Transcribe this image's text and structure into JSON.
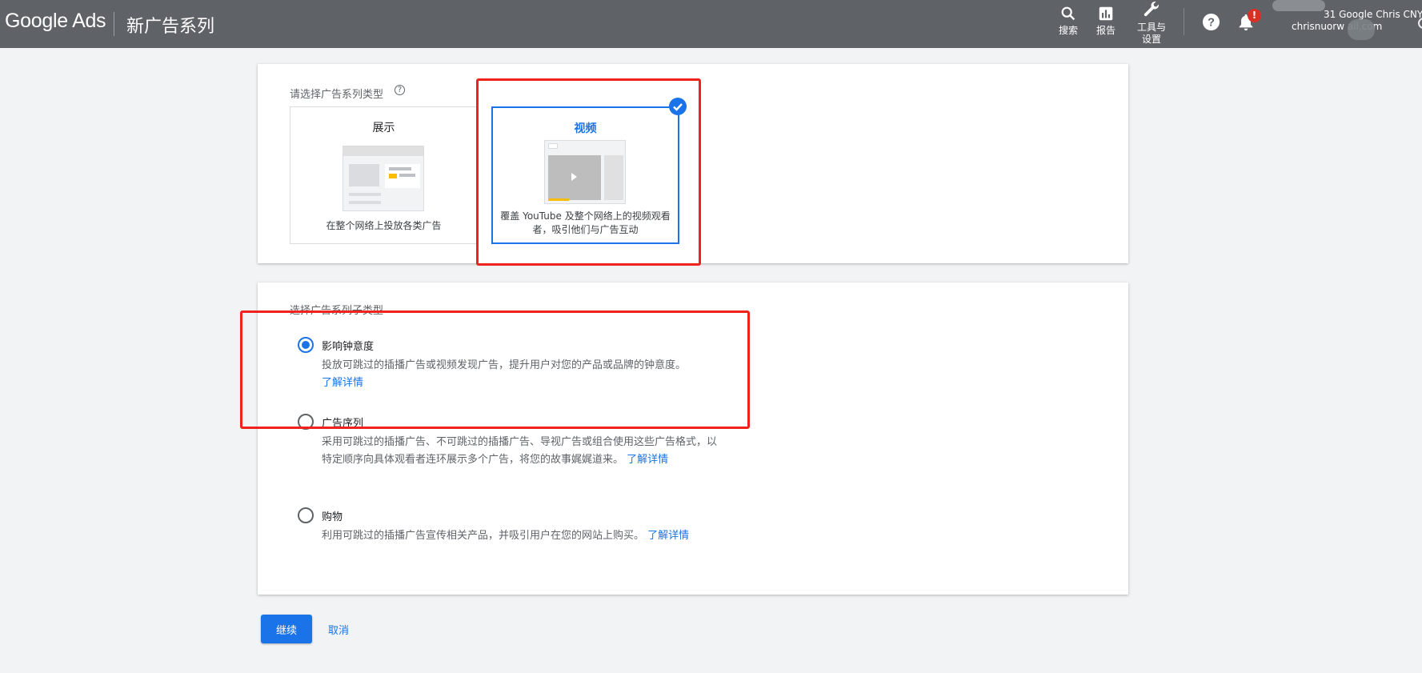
{
  "header": {
    "brand": "Google Ads",
    "page_title": "新广告系列",
    "tools": [
      {
        "icon": "search-icon",
        "label": "搜索"
      },
      {
        "icon": "reports-icon",
        "label": "报告"
      },
      {
        "icon": "wrench-icon",
        "label_line1": "工具与",
        "label_line2": "设置"
      }
    ],
    "notification_count": "!",
    "account_line1": "31 Google Chris CNY",
    "account_line2": "chrisnuorw     ail.com"
  },
  "campaign_type": {
    "label": "请选择广告系列类型",
    "tiles": [
      {
        "title": "展示",
        "description": "在整个网络上投放各类广告",
        "selected": false
      },
      {
        "title": "视频",
        "description": "覆盖 YouTube 及整个网络上的视频观看者，吸引他们与广告互动",
        "selected": true
      }
    ]
  },
  "subtype": {
    "label": "选择广告系列子类型",
    "options": [
      {
        "title": "影响钟意度",
        "description": "投放可跳过的插播广告或视频发现广告，提升用户对您的产品或品牌的钟意度。",
        "link": "了解详情",
        "selected": true
      },
      {
        "title": "广告序列",
        "description": "采用可跳过的插播广告、不可跳过的插播广告、导视广告或组合使用这些广告格式，以特定顺序向具体观看者连环展示多个广告，将您的故事娓娓道来。",
        "link": "了解详情",
        "selected": false
      },
      {
        "title": "购物",
        "description": "利用可跳过的插播广告宣传相关产品，并吸引用户在您的网站上购买。",
        "link": "了解详情",
        "selected": false
      }
    ]
  },
  "actions": {
    "continue_label": "继续",
    "cancel_label": "取消"
  },
  "colors": {
    "header_bg": "#5f6368",
    "accent": "#1a73e8",
    "annotation_red": "#f0221e",
    "page_bg": "#f1f3f4"
  }
}
